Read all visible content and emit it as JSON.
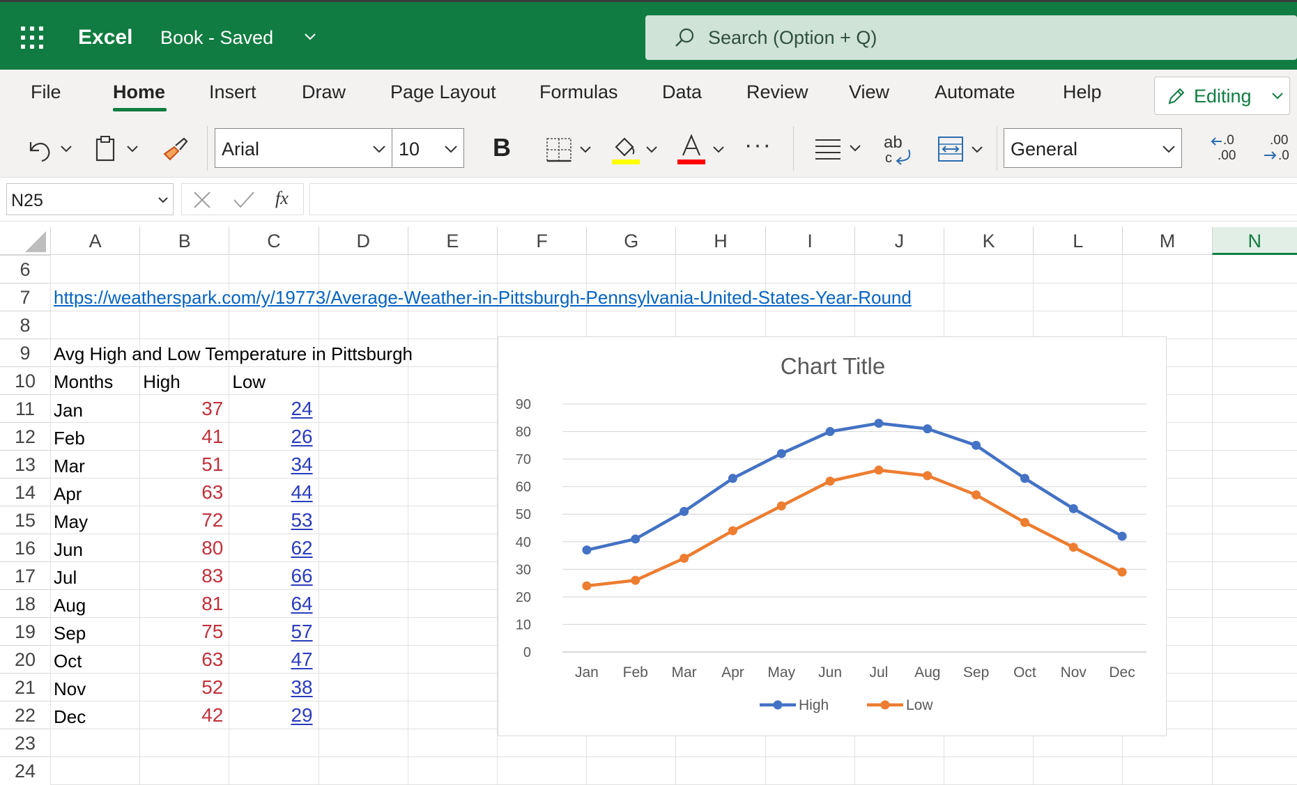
{
  "app": {
    "name": "Excel",
    "doc_title": "Book - Saved"
  },
  "search": {
    "placeholder": "Search (Option + Q)"
  },
  "ribbon": {
    "tabs": [
      "File",
      "Home",
      "Insert",
      "Draw",
      "Page Layout",
      "Formulas",
      "Data",
      "Review",
      "View",
      "Automate",
      "Help"
    ],
    "active_tab": "Home",
    "editing_label": "Editing"
  },
  "toolbar": {
    "font_name": "Arial",
    "font_size": "10",
    "bold_label": "B",
    "font_color_label": "A",
    "more_label": "···",
    "wrap_label": "ab",
    "number_format": "General",
    "increase_decimal_label": ".0",
    "decrease_decimal_label": ".00",
    "fill_color": "#ffff00",
    "font_color": "#ff0000"
  },
  "formula_bar": {
    "name_box": "N25",
    "fx_label": "fx",
    "value": ""
  },
  "grid": {
    "columns": [
      "A",
      "B",
      "C",
      "D",
      "E",
      "F",
      "G",
      "H",
      "I",
      "J",
      "K",
      "L",
      "M",
      "N"
    ],
    "selected_column": "N",
    "rows": [
      "6",
      "7",
      "8",
      "9",
      "10",
      "11",
      "12",
      "13",
      "14",
      "15",
      "16",
      "17",
      "18",
      "19",
      "20",
      "21",
      "22",
      "23",
      "24"
    ],
    "link": "https://weatherspark.com/y/19773/Average-Weather-in-Pittsburgh-Pennsylvania-United-States-Year-Round",
    "table_title": "Avg High and Low Temperature in Pittsburgh",
    "headers": [
      "Months",
      "High",
      "Low"
    ],
    "data": [
      [
        "Jan",
        "37",
        "24"
      ],
      [
        "Feb",
        "41",
        "26"
      ],
      [
        "Mar",
        "51",
        "34"
      ],
      [
        "Apr",
        "63",
        "44"
      ],
      [
        "May",
        "72",
        "53"
      ],
      [
        "Jun",
        "80",
        "62"
      ],
      [
        "Jul",
        "83",
        "66"
      ],
      [
        "Aug",
        "81",
        "64"
      ],
      [
        "Sep",
        "75",
        "57"
      ],
      [
        "Oct",
        "63",
        "47"
      ],
      [
        "Nov",
        "52",
        "38"
      ],
      [
        "Dec",
        "42",
        "29"
      ]
    ]
  },
  "chart_data": {
    "type": "line",
    "title": "Chart Title",
    "categories": [
      "Jan",
      "Feb",
      "Mar",
      "Apr",
      "May",
      "Jun",
      "Jul",
      "Aug",
      "Sep",
      "Oct",
      "Nov",
      "Dec"
    ],
    "series": [
      {
        "name": "High",
        "values": [
          37,
          41,
          51,
          63,
          72,
          80,
          83,
          81,
          75,
          63,
          52,
          42
        ],
        "color": "#4472c4"
      },
      {
        "name": "Low",
        "values": [
          24,
          26,
          34,
          44,
          53,
          62,
          66,
          64,
          57,
          47,
          38,
          29
        ],
        "color": "#ed7d31"
      }
    ],
    "ylim": [
      0,
      90
    ],
    "yticks": [
      0,
      10,
      20,
      30,
      40,
      50,
      60,
      70,
      80,
      90
    ],
    "grid": true,
    "legend": "bottom"
  }
}
